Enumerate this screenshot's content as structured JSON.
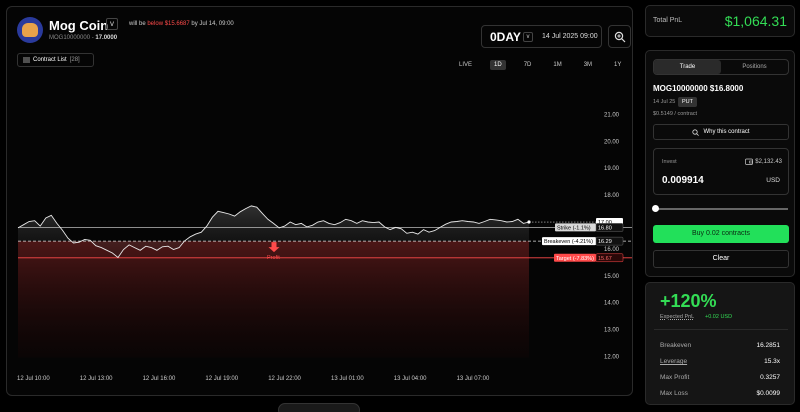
{
  "header": {
    "coin_name": "Mog Coin",
    "coin_sub_prefix": "MOG10000000 - ",
    "coin_sub_value": "17.0000",
    "prediction_prefix": "will be ",
    "prediction_red": "below $15.6687",
    "prediction_suffix": " by Jul 14, 09:00",
    "period_value": "0DAY",
    "period_date": "14 Jul 2025 09:00",
    "caret": "v",
    "contract_list_label": "Contract List",
    "contract_list_count": "[28]"
  },
  "ranges": [
    "LIVE",
    "1D",
    "7D",
    "1M",
    "3M",
    "1Y"
  ],
  "active_range": "1D",
  "chart_data": {
    "type": "line",
    "ylim": [
      12,
      21.5
    ],
    "y_ticks": [
      "21.00",
      "20.00",
      "19.00",
      "18.00",
      "17.00",
      "16.00",
      "15.00",
      "14.00",
      "13.00",
      "12.00"
    ],
    "y_tick_values": [
      21,
      20,
      19,
      18,
      17,
      16,
      15,
      14,
      13,
      12
    ],
    "x_ticks": [
      "12 Jul 10:00",
      "12 Jul 13:00",
      "12 Jul 16:00",
      "12 Jul 19:00",
      "12 Jul 22:00",
      "13 Jul 01:00",
      "13 Jul 04:00",
      "13 Jul 07:00"
    ],
    "price_series": [
      16.78,
      16.9,
      17.02,
      17.05,
      16.85,
      17.15,
      17.25,
      16.95,
      16.7,
      16.4,
      16.22,
      16.25,
      16.35,
      16.32,
      16.12,
      16.05,
      15.95,
      15.85,
      15.68,
      15.98,
      16.15,
      16.05,
      15.95,
      16.1,
      16.05,
      15.95,
      16.08,
      16.1,
      15.98,
      16.05,
      16.3,
      16.45,
      16.55,
      16.62,
      16.85,
      17.18,
      17.4,
      17.35,
      17.3,
      17.22,
      17.38,
      17.5,
      17.6,
      17.55,
      17.32,
      17.1,
      16.95,
      16.78,
      16.85,
      17.0,
      16.9,
      16.95,
      16.82,
      16.88,
      17.0,
      17.05,
      16.95,
      16.9,
      16.98,
      17.1,
      17.05,
      16.95,
      17.05,
      17.0,
      16.98,
      17.0,
      16.82,
      16.72,
      16.8,
      16.75,
      16.58,
      16.62,
      16.55,
      16.72,
      16.62,
      16.68,
      16.8,
      16.92,
      17.0,
      17.02,
      17.05,
      17.02,
      17.0,
      16.95,
      17.02,
      17.1,
      17.08,
      17.05,
      17.0,
      17.02,
      17.1,
      16.95,
      17.0
    ],
    "current_price": 17.0,
    "strike": 16.8,
    "breakeven": 16.29,
    "target": 15.67,
    "current_label": "17.00",
    "strike_label": "Strike (-1.1%)",
    "strike_value": "16.80",
    "breakeven_label": "Breakeven (-4.21%)",
    "breakeven_value": "16.29",
    "target_label": "Target (-7.83%)",
    "target_value": "15.67",
    "profit_label": "Profit"
  },
  "summary": {
    "total_label": "Total PnL",
    "total_value": "$1,064.31"
  },
  "trade": {
    "tab_trade": "Trade",
    "tab_positions": "Positions",
    "title": "MOG10000000 $16.8000",
    "date": "14 Jul 25",
    "type": "PUT",
    "price_per_contract": "$0.5149 / contract",
    "why_label": "Why this contract",
    "invest_label": "Invest",
    "wallet_balance": "$2,132.43",
    "invest_amount": "0.009914",
    "invest_currency": "USD",
    "buy_label": "Buy 0.02 contracts",
    "clear_label": "Clear"
  },
  "stats": {
    "pct": "+120%",
    "expected_label": "Expected PnL",
    "expected_value": "+0.02 USD",
    "rows": [
      {
        "k": "Breakeven",
        "v": "16.2851"
      },
      {
        "k": "Leverage",
        "v": "15.3x"
      },
      {
        "k": "Max Profit",
        "v": "0.3257"
      },
      {
        "k": "Max Loss",
        "v": "$0.0099"
      }
    ]
  },
  "colors": {
    "accent_green": "#33dd55",
    "button_green": "#22e05a",
    "target_red": "#ff4a4a"
  }
}
